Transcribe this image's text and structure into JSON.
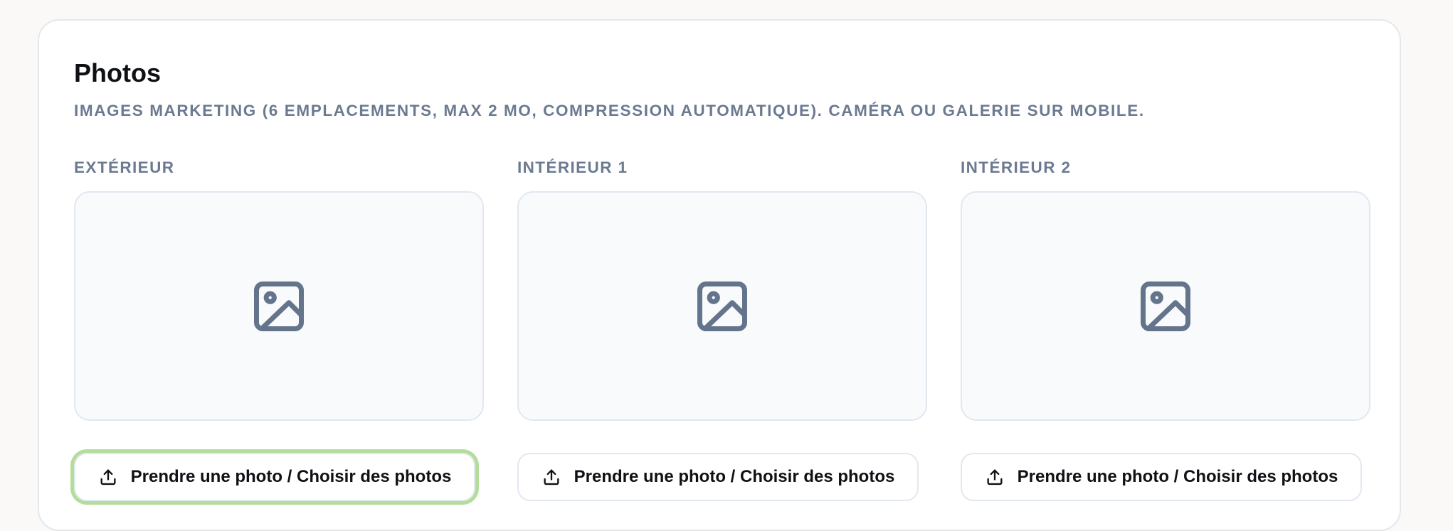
{
  "section": {
    "title": "Photos",
    "subtitle": "IMAGES MARKETING (6 EMPLACEMENTS, MAX 2 MO, COMPRESSION AUTOMATIQUE). CAMÉRA OU GALERIE SUR MOBILE."
  },
  "slots": [
    {
      "label": "EXTÉRIEUR",
      "placeholder_icon": "image-placeholder-icon",
      "button_label": "Prendre une photo / Choisir des photos",
      "button_icon": "upload-icon",
      "focused": true
    },
    {
      "label": "INTÉRIEUR 1",
      "placeholder_icon": "image-placeholder-icon",
      "button_label": "Prendre une photo / Choisir des photos",
      "button_icon": "upload-icon",
      "focused": false
    },
    {
      "label": "INTÉRIEUR 2",
      "placeholder_icon": "image-placeholder-icon",
      "button_label": "Prendre une photo / Choisir des photos",
      "button_icon": "upload-icon",
      "focused": false
    }
  ],
  "colors": {
    "title": "#0f1115",
    "muted_label": "#6b7a90",
    "icon": "#64748b",
    "focus_ring": "#b4dd9c",
    "dropzone_bg": "#f8fafc",
    "border": "#e2e8f0"
  }
}
